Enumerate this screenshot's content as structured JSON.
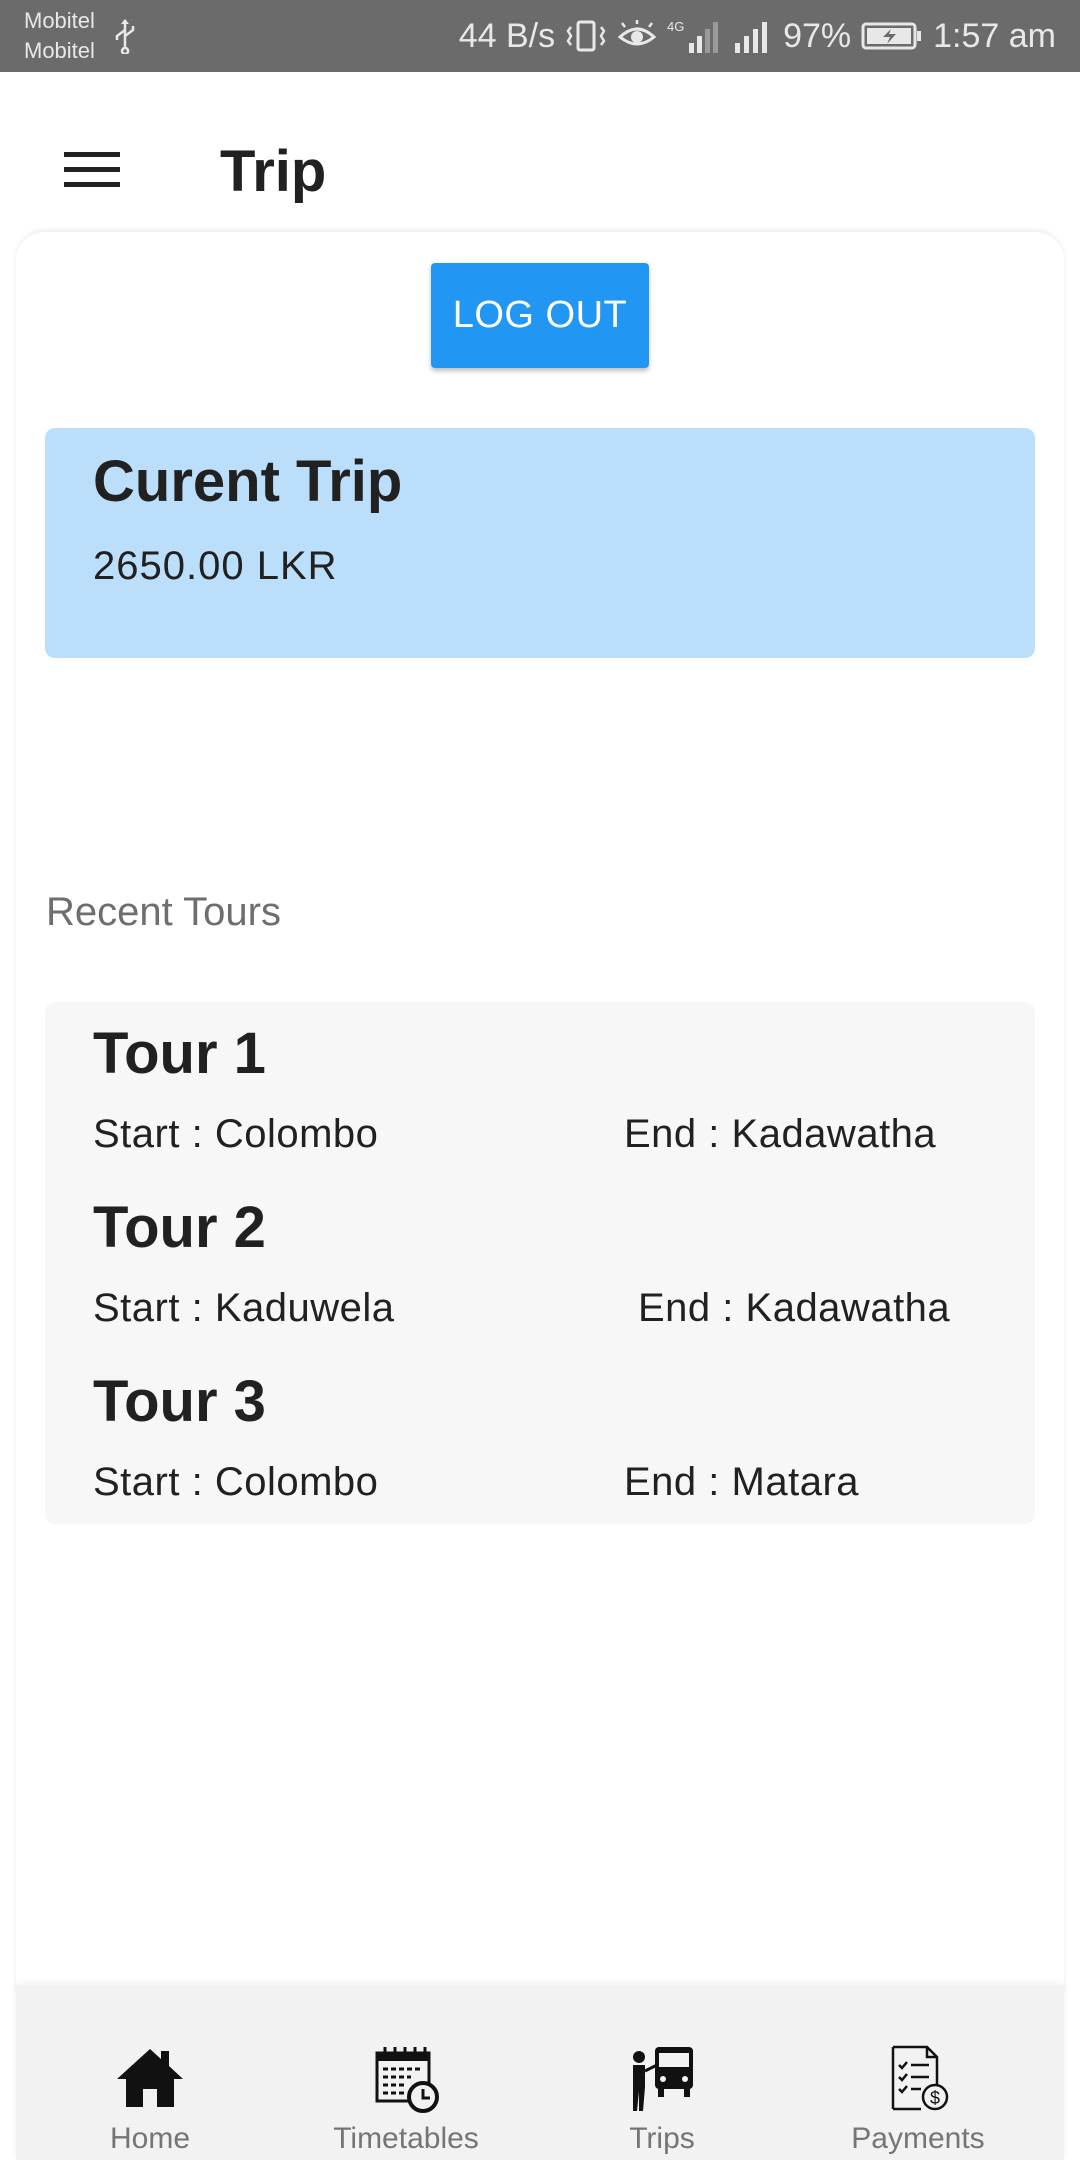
{
  "status_bar": {
    "carrier_1": "Mobitel",
    "carrier_2": "Mobitel",
    "net_speed": "44 B/s",
    "network_type": "4G",
    "battery": "97%",
    "time": "1:57 am"
  },
  "app_bar": {
    "title": "Trip",
    "menu_icon": "hamburger-menu-icon"
  },
  "main": {
    "logout_label": "LOG OUT",
    "current_trip": {
      "title": "Curent Trip",
      "amount": "2650.00 LKR"
    },
    "recent_tours_label": "Recent Tours",
    "tours": [
      {
        "name": "Tour 1",
        "start": "Start : Colombo",
        "end": "End : Kadawatha"
      },
      {
        "name": "Tour 2",
        "start": "Start : Kaduwela",
        "end": "End : Kadawatha"
      },
      {
        "name": "Tour 3",
        "start": "Start : Colombo",
        "end": "End : Matara"
      }
    ]
  },
  "bottom_nav": {
    "items": [
      {
        "label": "Home",
        "icon": "home-icon"
      },
      {
        "label": "Timetables",
        "icon": "calendar-clock-icon"
      },
      {
        "label": "Trips",
        "icon": "bus-trip-icon"
      },
      {
        "label": "Payments",
        "icon": "invoice-payment-icon"
      }
    ]
  },
  "colors": {
    "status_bar": "#6b6b6b",
    "accent": "#2196f3",
    "current_trip_card": "#bbdefb",
    "tours_card": "#f7f7f7",
    "bottom_nav": "#f2f2f2"
  }
}
